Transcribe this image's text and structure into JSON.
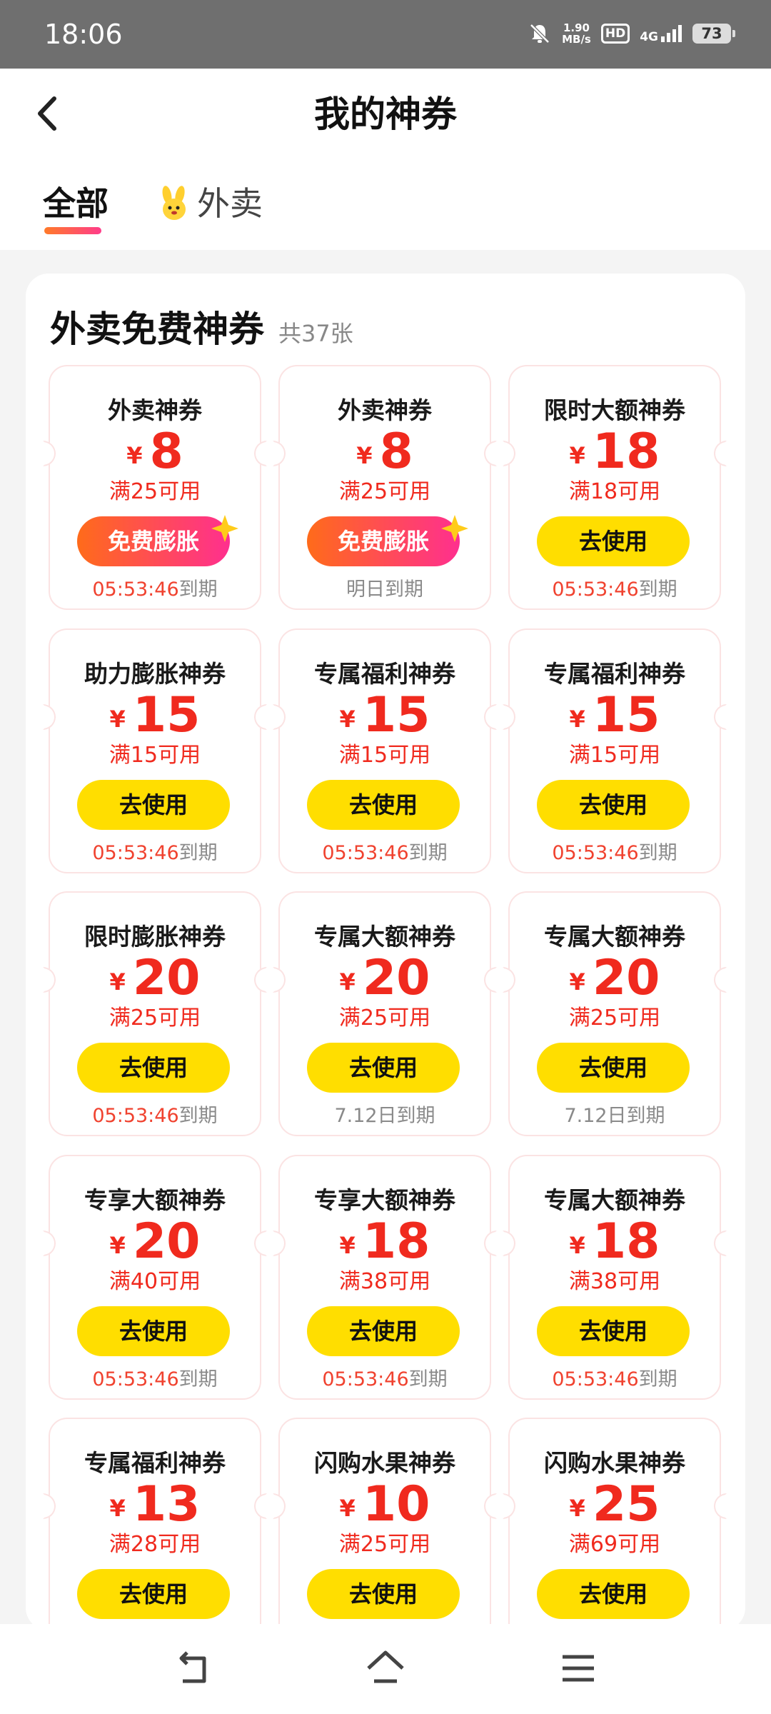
{
  "status_bar": {
    "time": "18:06",
    "net_speed_top": "1.90",
    "net_speed_bottom": "MB/s",
    "hd": "HD",
    "signal": "4G",
    "battery": "73"
  },
  "nav": {
    "title": "我的神券"
  },
  "tabs": [
    {
      "label": "全部"
    },
    {
      "label": "外卖"
    }
  ],
  "section": {
    "title": "外卖免费神券",
    "count": "共37张"
  },
  "currency": "¥",
  "coupons": [
    {
      "title": "外卖神券",
      "amount": "8",
      "condition": "满25可用",
      "button": "免费膨胀",
      "expire_time": "05:53:46",
      "expire_suffix": "到期"
    },
    {
      "title": "外卖神券",
      "amount": "8",
      "condition": "满25可用",
      "button": "免费膨胀",
      "expire_time": "",
      "expire_suffix": "明日到期"
    },
    {
      "title": "限时大额神券",
      "amount": "18",
      "condition": "满18可用",
      "button": "去使用",
      "expire_time": "05:53:46",
      "expire_suffix": "到期"
    },
    {
      "title": "助力膨胀神券",
      "amount": "15",
      "condition": "满15可用",
      "button": "去使用",
      "expire_time": "05:53:46",
      "expire_suffix": "到期"
    },
    {
      "title": "专属福利神券",
      "amount": "15",
      "condition": "满15可用",
      "button": "去使用",
      "expire_time": "05:53:46",
      "expire_suffix": "到期"
    },
    {
      "title": "专属福利神券",
      "amount": "15",
      "condition": "满15可用",
      "button": "去使用",
      "expire_time": "05:53:46",
      "expire_suffix": "到期"
    },
    {
      "title": "限时膨胀神券",
      "amount": "20",
      "condition": "满25可用",
      "button": "去使用",
      "expire_time": "05:53:46",
      "expire_suffix": "到期"
    },
    {
      "title": "专属大额神券",
      "amount": "20",
      "condition": "满25可用",
      "button": "去使用",
      "expire_time": "",
      "expire_suffix": "7.12日到期"
    },
    {
      "title": "专属大额神券",
      "amount": "20",
      "condition": "满25可用",
      "button": "去使用",
      "expire_time": "",
      "expire_suffix": "7.12日到期"
    },
    {
      "title": "专享大额神券",
      "amount": "20",
      "condition": "满40可用",
      "button": "去使用",
      "expire_time": "05:53:46",
      "expire_suffix": "到期"
    },
    {
      "title": "专享大额神券",
      "amount": "18",
      "condition": "满38可用",
      "button": "去使用",
      "expire_time": "05:53:46",
      "expire_suffix": "到期"
    },
    {
      "title": "专属大额神券",
      "amount": "18",
      "condition": "满38可用",
      "button": "去使用",
      "expire_time": "05:53:46",
      "expire_suffix": "到期"
    },
    {
      "title": "专属福利神券",
      "amount": "13",
      "condition": "满28可用",
      "button": "去使用",
      "expire_time": "",
      "expire_suffix": ""
    },
    {
      "title": "闪购水果神券",
      "amount": "10",
      "condition": "满25可用",
      "button": "去使用",
      "expire_time": "",
      "expire_suffix": ""
    },
    {
      "title": "闪购水果神券",
      "amount": "25",
      "condition": "满69可用",
      "button": "去使用",
      "expire_time": "",
      "expire_suffix": ""
    }
  ],
  "icons": {
    "back": "chevron-left-icon",
    "takeout_tab": "bunny-mascot-icon",
    "sparkle": "sparkle-star-icon",
    "nav_back": "nav-back-icon",
    "nav_home": "nav-home-icon",
    "nav_menu": "nav-menu-icon"
  },
  "colors": {
    "accent_red": "#f02a1e",
    "button_yellow": "#ffde00",
    "special_gradient_start": "#ff6b1a",
    "special_gradient_end": "#ff2f8f"
  }
}
